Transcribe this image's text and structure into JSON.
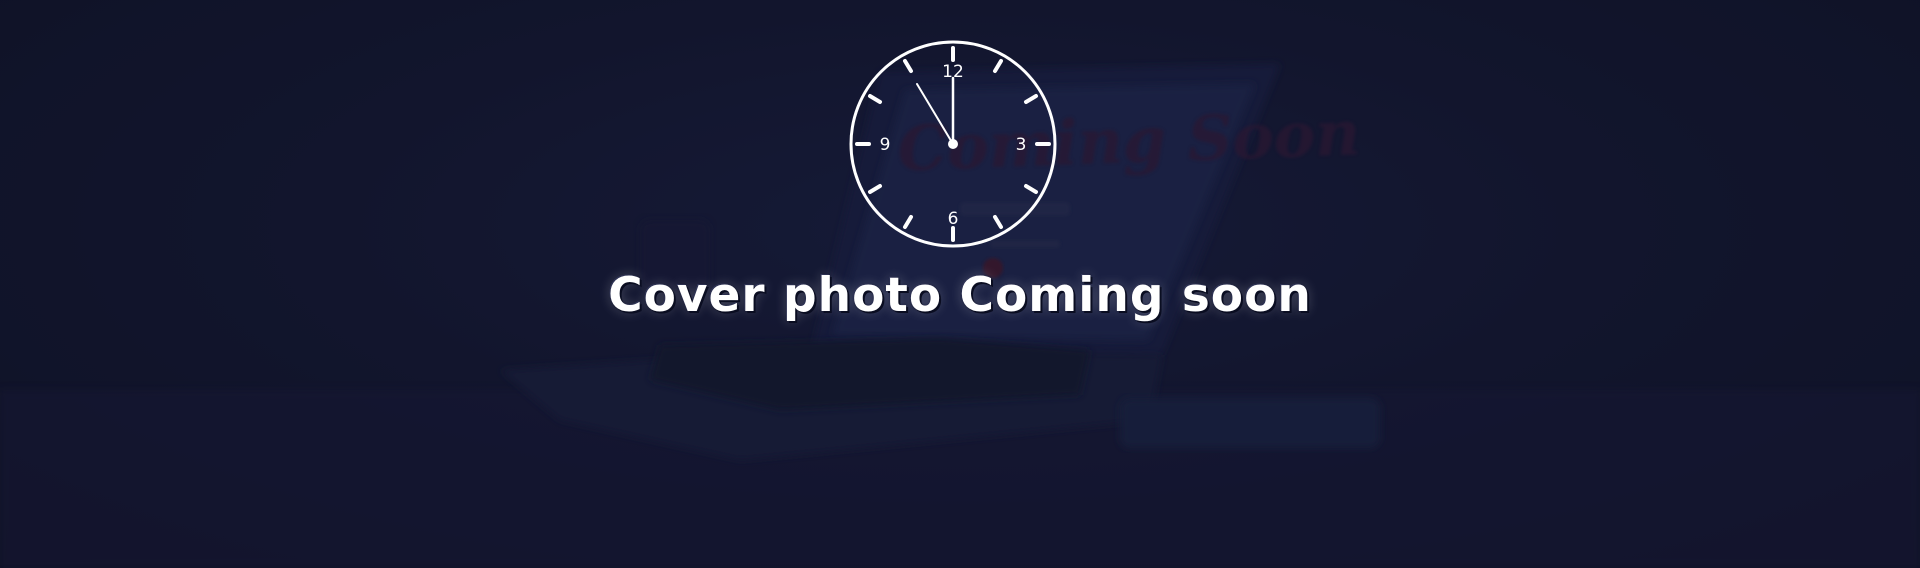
{
  "cover": {
    "headline": "Cover photo Coming soon",
    "background_hint": "Coming Soon"
  },
  "clock": {
    "numerals": {
      "twelve": "12",
      "three": "3",
      "six": "6",
      "nine": "9"
    },
    "icon": "clock-icon"
  },
  "colors": {
    "background": "#151a33",
    "foreground": "#ffffff",
    "photo_accent": "#3a1d3a"
  }
}
